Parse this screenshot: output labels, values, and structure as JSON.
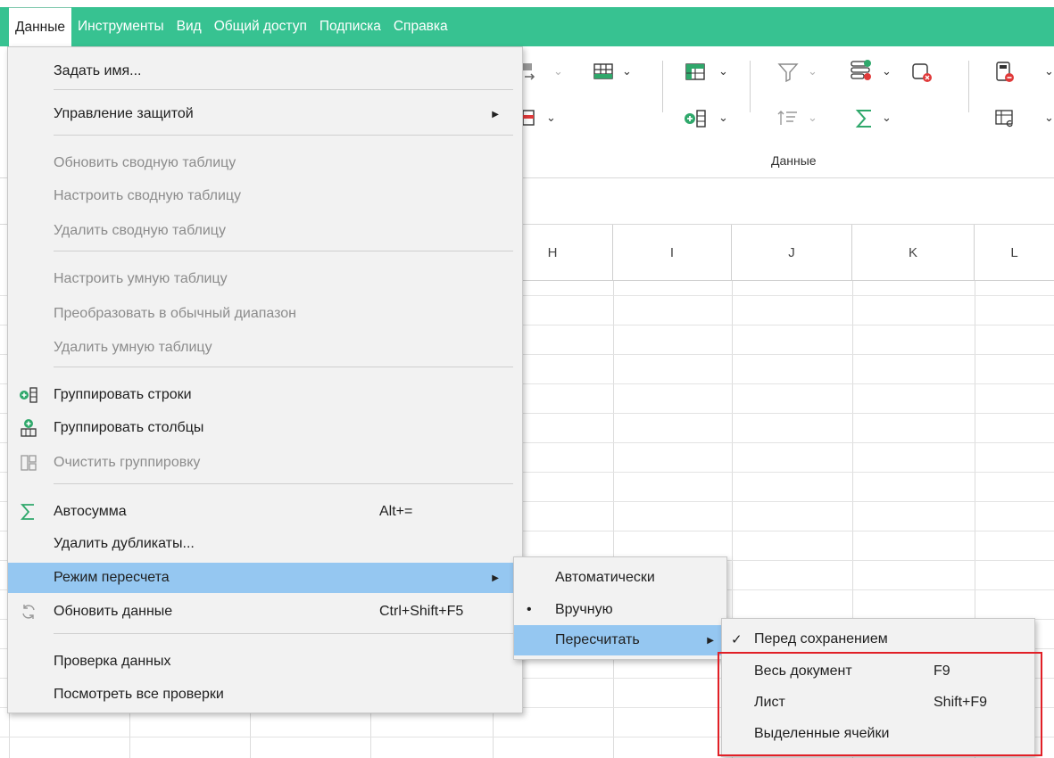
{
  "menubar": {
    "items": [
      "Данные",
      "Инструменты",
      "Вид",
      "Общий доступ",
      "Подписка",
      "Справка"
    ]
  },
  "ribbon": {
    "group_label": "Данные"
  },
  "columns": [
    "H",
    "I",
    "J",
    "K",
    "L"
  ],
  "data_menu": {
    "items": [
      {
        "label": "Задать имя...",
        "state": "enabled"
      },
      {
        "label": "Управление защитой",
        "state": "enabled",
        "submenu": true
      },
      {
        "label": "Обновить сводную таблицу",
        "state": "disabled"
      },
      {
        "label": "Настроить сводную таблицу",
        "state": "disabled"
      },
      {
        "label": "Удалить сводную таблицу",
        "state": "disabled"
      },
      {
        "label": "Настроить умную таблицу",
        "state": "disabled"
      },
      {
        "label": "Преобразовать в обычный диапазон",
        "state": "disabled"
      },
      {
        "label": "Удалить умную таблицу",
        "state": "disabled"
      },
      {
        "label": "Группировать строки",
        "state": "enabled",
        "icon": "group-rows-icon"
      },
      {
        "label": "Группировать столбцы",
        "state": "enabled",
        "icon": "group-columns-icon"
      },
      {
        "label": "Очистить группировку",
        "state": "disabled",
        "icon": "clear-grouping-icon"
      },
      {
        "label": "Автосумма",
        "state": "enabled",
        "icon": "sigma-icon",
        "shortcut": "Alt+="
      },
      {
        "label": "Удалить дубликаты...",
        "state": "enabled"
      },
      {
        "label": "Режим пересчета",
        "state": "highlighted",
        "submenu": true
      },
      {
        "label": "Обновить данные",
        "state": "enabled",
        "icon": "refresh-icon",
        "shortcut": "Ctrl+Shift+F5"
      },
      {
        "label": "Проверка данных",
        "state": "enabled"
      },
      {
        "label": "Посмотреть все проверки",
        "state": "enabled"
      }
    ]
  },
  "recalc_menu": {
    "items": [
      {
        "label": "Автоматически",
        "mark": ""
      },
      {
        "label": "Вручную",
        "mark": "•"
      },
      {
        "label": "Пересчитать",
        "mark": "",
        "submenu": true
      }
    ]
  },
  "recalc_sub_menu": {
    "items": [
      {
        "label": "Перед сохранением",
        "mark": "✓",
        "shortcut": ""
      },
      {
        "label": "Весь документ",
        "mark": "",
        "shortcut": "F9"
      },
      {
        "label": "Лист",
        "mark": "",
        "shortcut": "Shift+F9"
      },
      {
        "label": "Выделенные ячейки",
        "mark": "",
        "shortcut": ""
      }
    ]
  },
  "colors": {
    "accent": "#37c291",
    "highlight": "#95c7f1",
    "callout": "#e11f26"
  }
}
